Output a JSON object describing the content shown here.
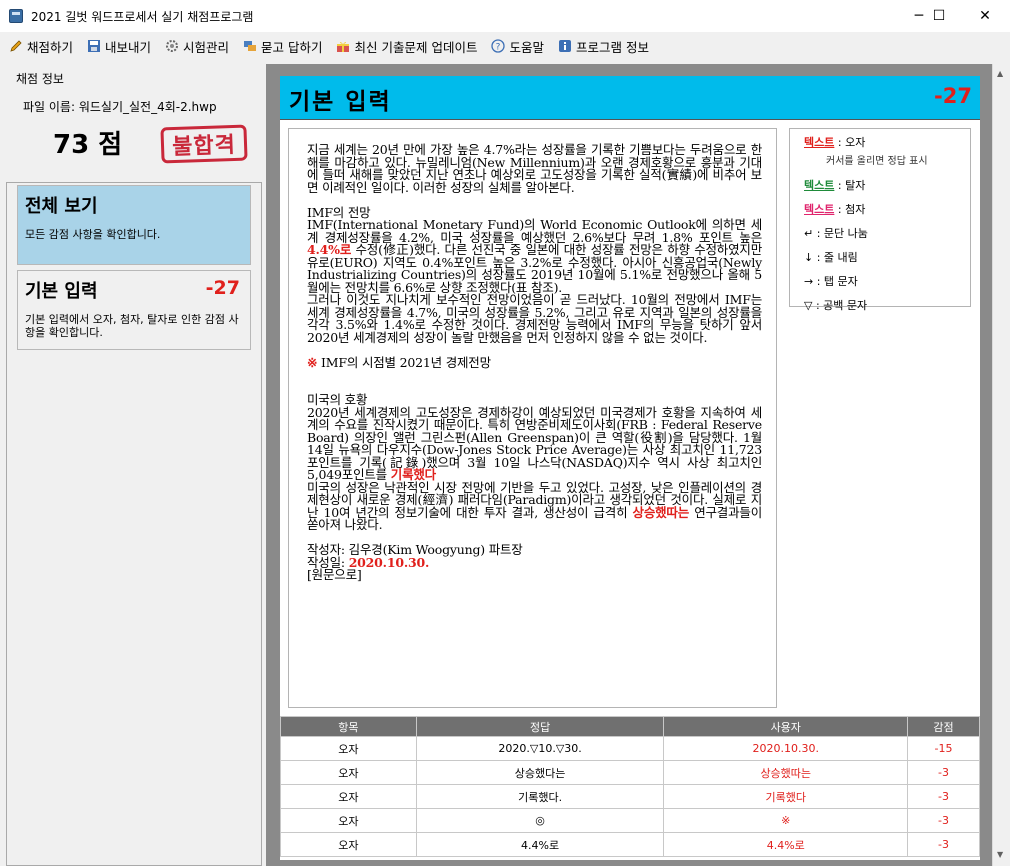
{
  "window": {
    "title": "2021 길벗 워드프로세서 실기 채점프로그램",
    "minimize": "─",
    "maximize": "☐",
    "close": "✕"
  },
  "menu": [
    {
      "label": "채점하기",
      "icon": "pencil-icon"
    },
    {
      "label": "내보내기",
      "icon": "save-icon"
    },
    {
      "label": "시험관리",
      "icon": "gear-icon"
    },
    {
      "label": "묻고 답하기",
      "icon": "chat-icon"
    },
    {
      "label": "최신 기출문제 업데이트",
      "icon": "gift-icon"
    },
    {
      "label": "도움말",
      "icon": "help-icon"
    },
    {
      "label": "프로그램 정보",
      "icon": "info-icon"
    }
  ],
  "score_info": {
    "group_label": "채점 정보",
    "file_name": "파일 이름: 워드실기_실전_4회-2.hwp",
    "score": "73 점",
    "result": "불합격"
  },
  "nav": [
    {
      "title": "전체 보기",
      "desc": "모든 감점 사항을 확인합니다.",
      "score": "",
      "selected": true
    },
    {
      "title": "기본 입력",
      "desc": "기본 입력에서 오자, 첨자, 탈자로 인한 감점 사항을 확인합니다.",
      "score": "-27",
      "selected": false
    }
  ],
  "section": {
    "title": "기본 입력",
    "score": "-27"
  },
  "document": {
    "p1": "지금 세계는 20년 만에 가장 높은 4.7%라는 성장률을 기록한 기쁨보다는 두려움으로 한해를 마감하고 있다. 뉴밀레니엄(New Millennium)과 오랜 경제호황으로 흥분과 기대에 들떠 새해를 맞았던 지난 연초나 예상외로 고도성장을 기록한 실적(實績)에 비추어 보면 이례적인 일이다. 이러한 성장의 실체를 알아본다.",
    "h1": "IMF의 전망",
    "p2a": "IMF(International Monetary Fund)의 World Economic Outlook에 의하면 세계 경제성장률을 4.2%, 미국 성장률을 예상했던 2.6%보다 무려 1.8% 포인트 높은 ",
    "p2red": "4.4%로",
    "p2b": " 수정(修正)했다. 다른 선진국 중 일본에 대한 성장률 전망은 하향 수정하였지만 유로(EURO) 지역도 0.4%포인트 높은 3.2%로 수정했다. 아시아 신흥공업국(Newly Industrializing Countries)의 성장률도 2019년 10월에 5.1%로 전망했으나 올해 5월에는 전망치를 6.6%로 상향 조정했다(표 참조).",
    "p3": "그러나 이것도 지나치게 보수적인 전망이었음이 곧 드러났다. 10월의 전망에서 IMF는 세계 경제성장률을 4.7%, 미국의 성장률을 5.2%, 그리고 유로 지역과 일본의 성장률을 각각 3.5%와 1.4%로 수정한 것이다. 경제전망 능력에서 IMF의 무능을 탓하기 앞서 2020년 세계경제의 성장이 놀랄 만했음을 먼저 인정하지 않을 수 없는 것이다.",
    "note_mark": "※",
    "note": " IMF의 시점별 2021년 경제전망",
    "h2": "미국의 호황",
    "p4a": "2020년 세계경제의 고도성장은 경제하강이 예상되었던 미국경제가 호황을 지속하여 세계의 수요를 진작시켰기 때문이다. 특히 연방준비제도이사회(FRB : Federal Reserve Board) 의장인 앨런 그린스펀(Allen Greenspan)이 큰 역할(役割)을 담당했다. 1월 14일 뉴욕의 다우지수(Dow-Jones Stock Price Average)는 사상 최고치인 11,723포인트를 기록(記錄)했으며 3월 10일 나스닥(NASDAQ)지수 역시 사상 최고치인 5,049포인트를 ",
    "p4red": "기록했다",
    "p5a": "미국의 성장은 낙관적인 시장 전망에 기반을 두고 있었다. 고성장, 낮은 인플레이션의 경제현상이 새로운 경제(經濟) 패러다임(Paradigm)이라고 생각되었던 것이다. 실제로 지난 10여 년간의 정보기술에 대한 투자 결과, 생산성이 급격히 ",
    "p5red": "상승했따는",
    "p5b": " 연구결과들이 쏟아져 나왔다.",
    "author": "작성자: 김우경(Kim Woogyung) 파트장",
    "date_label": "작성일: ",
    "date_red": "2020.10.30.",
    "origin": "[원문으로]"
  },
  "legend": {
    "typo_key": "텍스트",
    "typo_val": " : 오자",
    "typo_hint": "커서를 올리면 정답 표시",
    "omit_key": "텍스트",
    "omit_val": " : 탈자",
    "add_key": "텍스트",
    "add_val": " : 첨자",
    "para": "↵ : 문단 나눔",
    "line": "↓ : 줄 내림",
    "tab": "→ : 탭 문자",
    "space": "▽ : 공백 문자"
  },
  "table": {
    "headers": [
      "항목",
      "정답",
      "사용자",
      "감점"
    ],
    "rows": [
      {
        "item": "오자",
        "answer": "2020.▽10.▽30.",
        "user": "2020.10.30.",
        "deduct": "-15"
      },
      {
        "item": "오자",
        "answer": "상승했다는",
        "user": "상승했따는",
        "deduct": "-3"
      },
      {
        "item": "오자",
        "answer": "기록했다.",
        "user": "기록했다",
        "deduct": "-3"
      },
      {
        "item": "오자",
        "answer": "◎",
        "user": "※",
        "deduct": "-3"
      },
      {
        "item": "오자",
        "answer": "4.4%로",
        "user": "4.4%로",
        "deduct": "-3"
      }
    ]
  }
}
